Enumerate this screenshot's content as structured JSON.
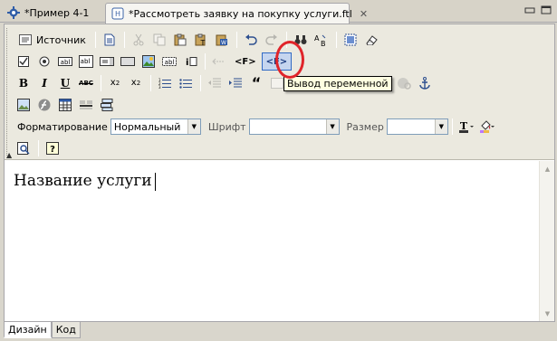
{
  "tabs": [
    {
      "label": "*Пример 4-1",
      "icon": "gear-project-icon",
      "active": false
    },
    {
      "label": "*Рассмотреть заявку на покупку услуги.ftl",
      "icon": "ftl-file-icon",
      "active": true,
      "close": "✕"
    }
  ],
  "window": {
    "minimize": "▭",
    "maximize": "▣"
  },
  "toolbar": {
    "row1": {
      "source_label": "Источник"
    },
    "row2": {
      "var_open": "<F>",
      "var_output": "<F>"
    },
    "format": {
      "format_label": "Форматирование",
      "format_value": "Нормальный",
      "font_label": "Шрифт",
      "font_value": "",
      "size_label": "Размер",
      "size_value": ""
    }
  },
  "tooltip": {
    "text": "Вывод переменной"
  },
  "content": {
    "text": "Название услуги"
  },
  "bottom_tabs": [
    {
      "label": "Дизайн",
      "active": true
    },
    {
      "label": "Код",
      "active": false
    }
  ],
  "colors": {
    "highlight_ring": "#e0242a",
    "tooltip_bg": "#ffffe1",
    "hover_bg": "#c5d5ef"
  }
}
